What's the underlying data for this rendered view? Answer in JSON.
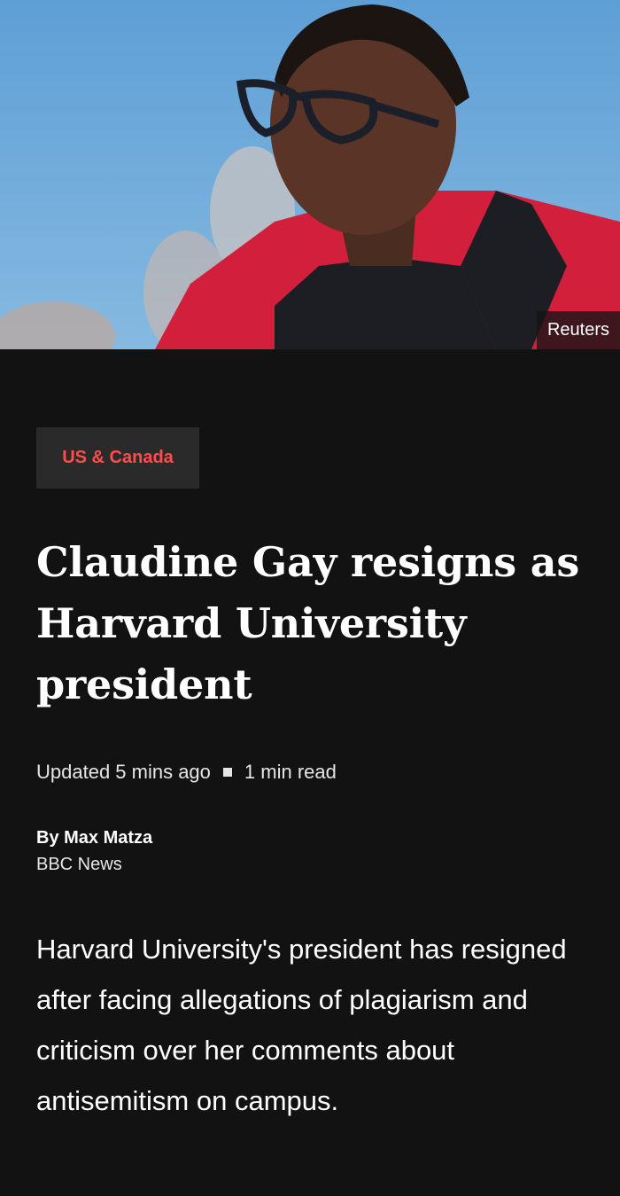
{
  "hero": {
    "image_alt": "Claudine Gay in academic regalia",
    "credit": "Reuters"
  },
  "article": {
    "section": "US & Canada",
    "headline": "Claudine Gay resigns as Harvard University president",
    "updated": "Updated 5 mins ago",
    "read_time": "1 min read",
    "author": "By Max Matza",
    "outlet": "BBC News",
    "summary": "Harvard University's president has resigned after facing allegations of plagiarism and criticism over her comments about antisemitism on campus."
  },
  "colors": {
    "background": "#121212",
    "section_tag_bg": "#2a2a2a",
    "section_tag_text": "#ff4c4c",
    "text": "#ffffff"
  }
}
